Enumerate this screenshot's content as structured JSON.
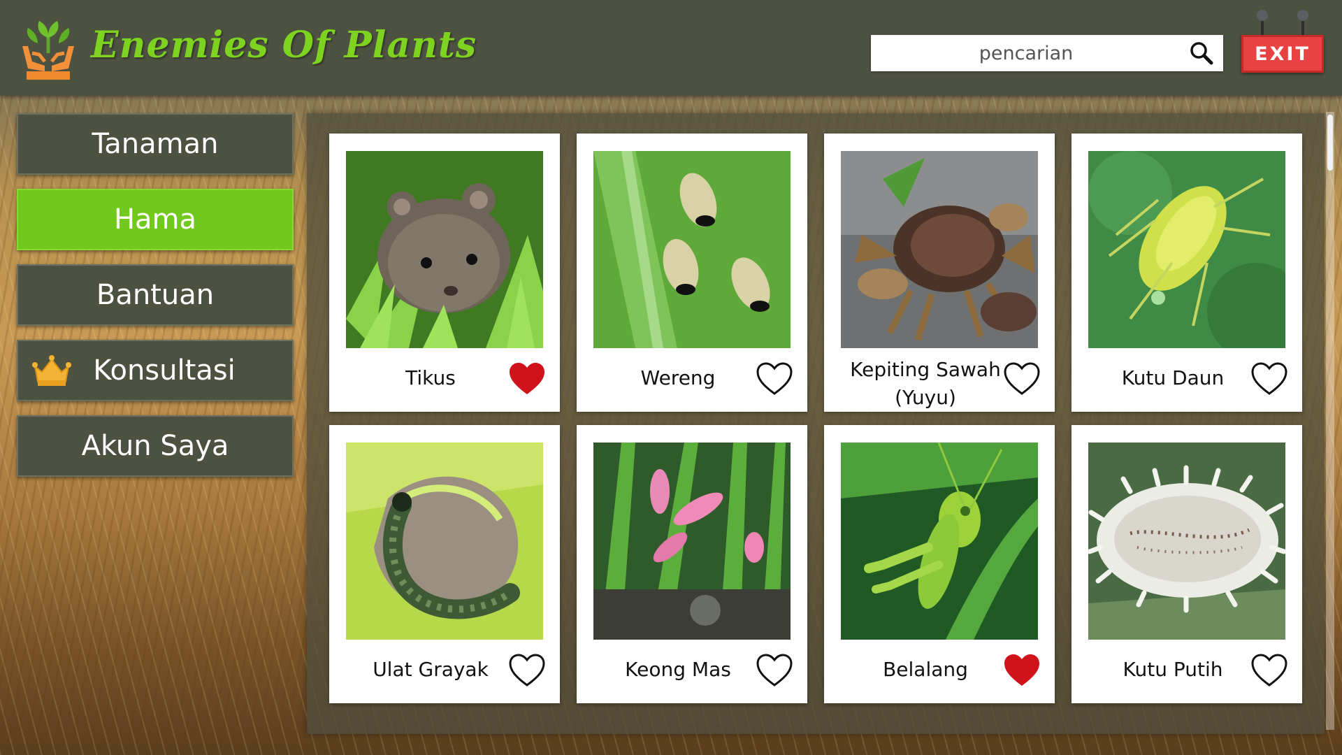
{
  "app": {
    "title": "Enemies Of Plants"
  },
  "search": {
    "placeholder": "pencarian"
  },
  "header": {
    "exit_label": "EXIT"
  },
  "sidebar": {
    "items": [
      {
        "label": "Tanaman",
        "active": false
      },
      {
        "label": "Hama",
        "active": true
      },
      {
        "label": "Bantuan",
        "active": false
      },
      {
        "label": "Konsultasi",
        "active": false,
        "icon": "crown-icon"
      },
      {
        "label": "Akun Saya",
        "active": false
      }
    ]
  },
  "pests": [
    {
      "name": "Tikus",
      "favorited": true
    },
    {
      "name": "Wereng",
      "favorited": false
    },
    {
      "name": "Kepiting Sawah (Yuyu)",
      "favorited": false
    },
    {
      "name": "Kutu Daun",
      "favorited": false
    },
    {
      "name": "Ulat Grayak",
      "favorited": false
    },
    {
      "name": "Keong Mas",
      "favorited": false
    },
    {
      "name": "Belalang",
      "favorited": true
    },
    {
      "name": "Kutu Putih",
      "favorited": false
    }
  ],
  "colors": {
    "header_bg": "#4d5140",
    "accent_green": "#72c91d",
    "title_green": "#7ed321",
    "heart_filled": "#d0121b",
    "exit_red": "#e84342"
  }
}
